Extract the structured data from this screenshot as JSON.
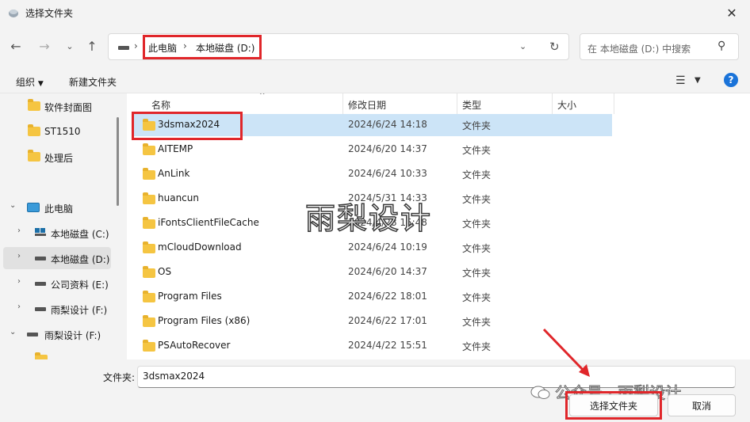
{
  "window": {
    "title": "选择文件夹"
  },
  "breadcrumbs": [
    "此电脑",
    "本地磁盘 (D:)"
  ],
  "search": {
    "placeholder": "在 本地磁盘 (D:) 中搜索"
  },
  "toolbar": {
    "organize": "组织",
    "new_folder": "新建文件夹"
  },
  "nav_tree": [
    {
      "label": "软件封面图",
      "icon": "folder-icon",
      "level": 1
    },
    {
      "label": "ST1510",
      "icon": "folder-icon",
      "level": 1
    },
    {
      "label": "处理后",
      "icon": "folder-icon",
      "level": 1
    },
    {
      "label": "此电脑",
      "icon": "pc-icon",
      "level": 0,
      "expanded": true
    },
    {
      "label": "本地磁盘 (C:)",
      "icon": "drive-icon",
      "level": 1
    },
    {
      "label": "本地磁盘 (D:)",
      "icon": "drive-icon",
      "level": 1,
      "selected": true
    },
    {
      "label": "公司资料 (E:)",
      "icon": "drive-icon",
      "level": 1
    },
    {
      "label": "雨梨设计 (F:)",
      "icon": "drive-icon",
      "level": 1
    },
    {
      "label": "雨梨设计 (F:)",
      "icon": "drive-icon",
      "level": 0,
      "expanded": true
    }
  ],
  "columns": {
    "name": "名称",
    "modified": "修改日期",
    "type": "类型",
    "size": "大小"
  },
  "files": [
    {
      "name": "3dsmax2024",
      "modified": "2024/6/24 14:18",
      "type": "文件夹",
      "selected": true
    },
    {
      "name": "AITEMP",
      "modified": "2024/6/20 14:37",
      "type": "文件夹"
    },
    {
      "name": "AnLink",
      "modified": "2024/6/24 10:33",
      "type": "文件夹"
    },
    {
      "name": "huancun",
      "modified": "2024/5/31 14:33",
      "type": "文件夹"
    },
    {
      "name": "iFontsClientFileCache",
      "modified": "2024/4/28 15:48",
      "type": "文件夹"
    },
    {
      "name": "mCloudDownload",
      "modified": "2024/6/24 10:19",
      "type": "文件夹"
    },
    {
      "name": "OS",
      "modified": "2024/6/20 14:37",
      "type": "文件夹"
    },
    {
      "name": "Program Files",
      "modified": "2024/6/22 18:01",
      "type": "文件夹"
    },
    {
      "name": "Program Files (x86)",
      "modified": "2024/6/22 17:01",
      "type": "文件夹"
    },
    {
      "name": "PSAutoRecover",
      "modified": "2024/4/22 15:51",
      "type": "文件夹"
    }
  ],
  "bottom": {
    "folder_label": "文件夹:",
    "folder_value": "3dsmax2024",
    "select_button": "选择文件夹",
    "cancel_button": "取消"
  },
  "watermarks": {
    "center": "雨梨设计",
    "bottom": "公众号 · 雨梨设计"
  },
  "colors": {
    "highlight": "#e0262a",
    "selection": "#cce4f7",
    "accent": "#1a73d9"
  }
}
